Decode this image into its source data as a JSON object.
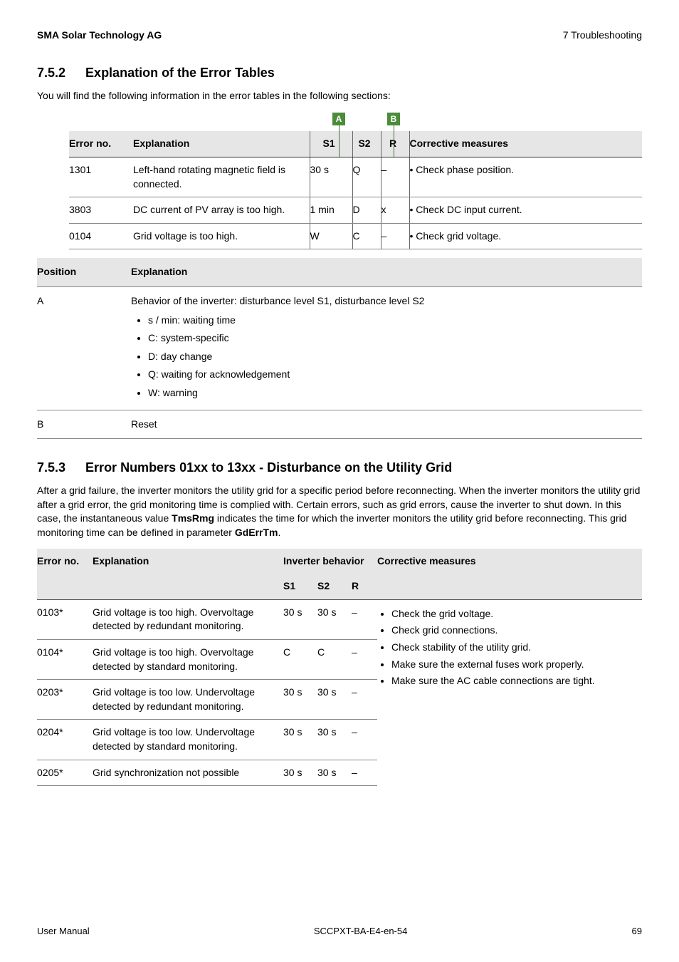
{
  "header": {
    "left": "SMA Solar Technology AG",
    "right": "7 Troubleshooting"
  },
  "sec752": {
    "num": "7.5.2",
    "title": "Explanation of the Error Tables",
    "intro": "You will find the following information in the error tables in the following sections:",
    "markerA": "A",
    "markerB": "B",
    "headers": {
      "eno": "Error no.",
      "exp": "Explanation",
      "s1": "S1",
      "s2": "S2",
      "r": "R",
      "cm": "Corrective measures"
    },
    "rows": [
      {
        "eno": "1301",
        "exp": "Left-hand rotating magnetic field is connected.",
        "s1": "30 s",
        "s2": "Q",
        "r": "–",
        "cm": "• Check phase position."
      },
      {
        "eno": "3803",
        "exp": "DC current of PV array is too high.",
        "s1": "1 min",
        "s2": "D",
        "r": "x",
        "cm": "• Check DC input current."
      },
      {
        "eno": "0104",
        "exp": "Grid voltage is too high.",
        "s1": "W",
        "s2": "C",
        "r": "–",
        "cm": "• Check grid voltage."
      }
    ],
    "posHeaders": {
      "pos": "Position",
      "exp": "Explanation"
    },
    "posA": {
      "pos": "A",
      "line": "Behavior of the inverter: disturbance level S1, disturbance level S2",
      "items": [
        "s / min: waiting time",
        "C: system-specific",
        "D: day change",
        "Q: waiting for acknowledgement",
        "W: warning"
      ]
    },
    "posB": {
      "pos": "B",
      "exp": "Reset"
    }
  },
  "sec753": {
    "num": "7.5.3",
    "title": "Error Numbers 01xx to 13xx - Disturbance on the Utility Grid",
    "para_a": "After a grid failure, the inverter monitors the utility grid for a specific period before reconnecting. When the inverter monitors the utility grid after a grid error, the grid monitoring time is complied with. Certain errors, such as grid errors, cause the inverter to shut down. In this case, the instantaneous value ",
    "bold1": "TmsRmg",
    "para_b": " indicates the time for which the inverter monitors the utility grid before reconnecting. This grid monitoring time can be defined in parameter ",
    "bold2": "GdErrTm",
    "para_c": ".",
    "headers": {
      "eno": "Error no.",
      "exp": "Explanation",
      "ib": "Inverter behavior",
      "cm": "Corrective measures",
      "s1": "S1",
      "s2": "S2",
      "r": "R"
    },
    "rows": [
      {
        "eno": "0103*",
        "exp": "Grid voltage is too high. Overvoltage detected by redundant monitoring.",
        "s1": "30 s",
        "s2": "30 s",
        "r": "–"
      },
      {
        "eno": "0104*",
        "exp": "Grid voltage is too high. Overvoltage detected by standard monitoring.",
        "s1": "C",
        "s2": "C",
        "r": "–"
      },
      {
        "eno": "0203*",
        "exp": "Grid voltage is too low. Undervoltage detected by redundant monitoring.",
        "s1": "30 s",
        "s2": "30 s",
        "r": "–"
      },
      {
        "eno": "0204*",
        "exp": "Grid voltage is too low. Undervoltage detected by standard monitoring.",
        "s1": "30 s",
        "s2": "30 s",
        "r": "–"
      },
      {
        "eno": "0205*",
        "exp": "Grid synchronization not possible",
        "s1": "30 s",
        "s2": "30 s",
        "r": "–"
      }
    ],
    "cmItems": [
      "Check the grid voltage.",
      "Check grid connections.",
      "Check stability of the utility grid.",
      "Make sure the external fuses work properly.",
      "Make sure the AC cable connections are tight."
    ]
  },
  "footer": {
    "left": "User Manual",
    "mid": "SCCPXT-BA-E4-en-54",
    "right": "69"
  }
}
